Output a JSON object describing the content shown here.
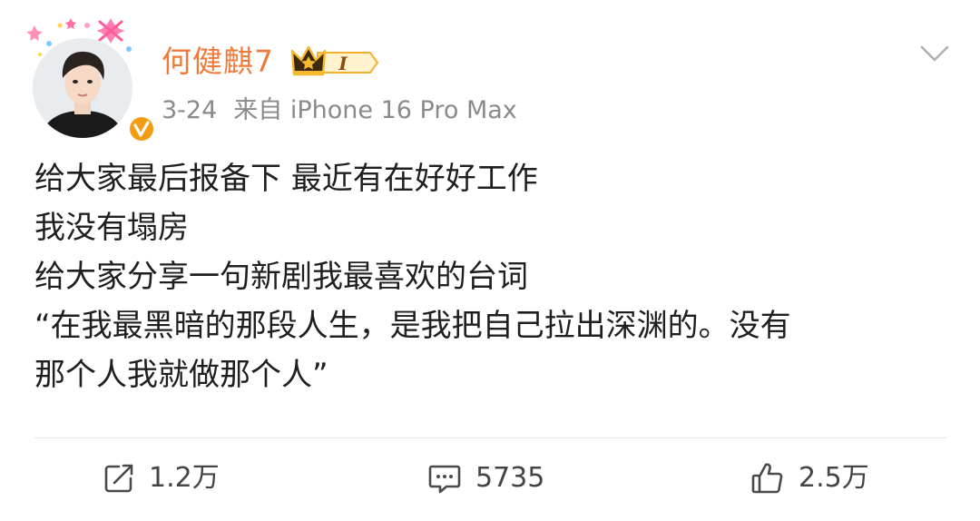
{
  "header": {
    "username": "何健麒7",
    "vip_level": "I",
    "date": "3-24",
    "source": "来自 iPhone 16 Pro Max"
  },
  "post": {
    "lines": [
      "给大家最后报备下 最近有在好好工作",
      "我没有塌房",
      "给大家分享一句新剧我最喜欢的台词",
      "“在我最黑暗的那段人生，是我把自己拉出深渊的。没有",
      "那个人我就做那个人”"
    ]
  },
  "actions": {
    "repost_count": "1.2万",
    "comment_count": "5735",
    "like_count": "2.5万"
  },
  "colors": {
    "username": "#f07a3a",
    "meta": "#8a8a8a",
    "text": "#1f1f1f",
    "verified": "#f39c12",
    "crown": "#f5b82e"
  },
  "icons": {
    "more": "chevron-down-icon",
    "repost": "repost-icon",
    "comment": "comment-icon",
    "like": "thumbs-up-icon",
    "verified": "verified-badge-icon",
    "vip": "crown-icon"
  }
}
